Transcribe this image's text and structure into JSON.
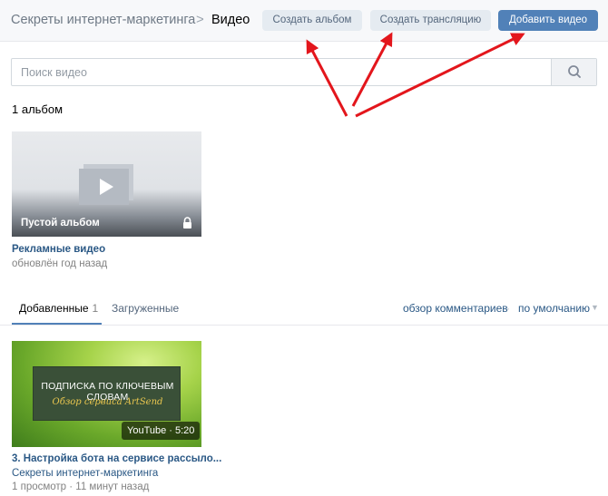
{
  "header": {
    "breadcrumb_group": "Секреты интернет-маркетинга",
    "separator": ">",
    "current_page": "Видео",
    "create_album_label": "Создать альбом",
    "create_stream_label": "Создать трансляцию",
    "add_video_label": "Добавить видео"
  },
  "search": {
    "placeholder": "Поиск видео",
    "value": "",
    "icon": "search-icon"
  },
  "albums": {
    "count_label": "1 альбом",
    "items": [
      {
        "caption": "Пустой альбом",
        "name": "Рекламные видео",
        "updated": "обновлён год назад",
        "private_icon": "lock-icon"
      }
    ]
  },
  "tabs": {
    "items": [
      {
        "label": "Добавленные",
        "count": "1",
        "active": true
      },
      {
        "label": "Загруженные",
        "active": false
      }
    ],
    "sort_comments": "обзор комментариев",
    "sort_separator": "·",
    "sort_default": "по умолчанию"
  },
  "videos": [
    {
      "thumb_line1": "ПОДПИСКА ПО КЛЮЧЕВЫМ СЛОВАМ",
      "thumb_line2": "Обзор сервиса ArtSend",
      "duration": "YouTube · 5:20",
      "title": "3. Настройка бота на сервисе рассыло...",
      "channel": "Секреты интернет-маркетинга",
      "meta": "1 просмотр · 11 минут назад"
    }
  ],
  "colors": {
    "accent": "#5181b8",
    "link": "#2a5885",
    "annotation_arrow": "#e3161c"
  }
}
